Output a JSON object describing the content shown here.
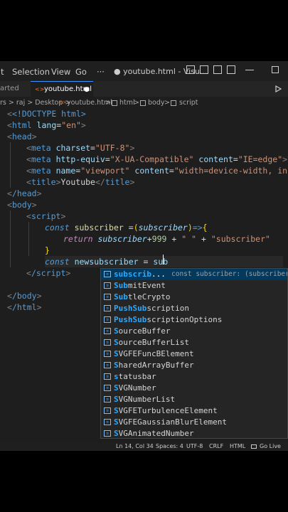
{
  "menu": {
    "item1": "t",
    "item2": "Selection",
    "item3": "View",
    "item4": "Go",
    "more": "···"
  },
  "window": {
    "title": "● youtube.html - Visu..."
  },
  "tabs": {
    "left": "arted",
    "active": "youtube.html",
    "active_modified_dot": "●"
  },
  "breadcrumb": {
    "p1": "rs > raj > Desktop >",
    "p2": "youtube.html",
    "p3": "html",
    "p4": "body",
    "p5": "script",
    "sep": ">"
  },
  "code": {
    "l1": "<!DOCTYPE html>",
    "l2_tag": "html",
    "l2_attr": "lang",
    "l2_val": "\"en\"",
    "l3_tag": "head",
    "l4_tag": "meta",
    "l4_attr": "charset",
    "l4_val": "\"UTF-8\"",
    "l5_tag": "meta",
    "l5_attr1": "http-equiv",
    "l5_val1": "\"X-UA-Compatible\"",
    "l5_attr2": "content",
    "l5_val2": "\"IE=edge\"",
    "l6_tag": "meta",
    "l6_attr1": "name",
    "l6_val1": "\"viewport\"",
    "l6_attr2": "content",
    "l6_val2": "\"width=device-width, ini",
    "l7_tag": "title",
    "l7_text": "Youtube",
    "l8_tag": "/head",
    "l9_tag": "body",
    "l10_tag": "script",
    "l11_kw": "const",
    "l11_name": "subscriber",
    "l11_param": "subscriber",
    "l12_kw": "return",
    "l12_var": "subscriber",
    "l12_num": "999",
    "l12_s1": "\" \"",
    "l12_s2": "\"subscriber\"",
    "l13": "}",
    "l14_kw": "const",
    "l14_name": "newsubscriber",
    "l14_typed": "sub",
    "l15_tag": "/script",
    "l17_tag": "/body",
    "l18_tag": "/html"
  },
  "suggestions": [
    {
      "match": "subscrib",
      "rest": "...",
      "detail": "const subscriber: (subscriber"
    },
    {
      "match": "Sub",
      "rest": "mitEvent"
    },
    {
      "match": "Sub",
      "rest": "tleCrypto"
    },
    {
      "match": "PushSub",
      "rest": "scription"
    },
    {
      "match": "PushSub",
      "rest": "scriptionOptions"
    },
    {
      "match": "S",
      "rest": "ourceBuffer"
    },
    {
      "match": "S",
      "rest": "ourceBufferList"
    },
    {
      "match": "S",
      "rest": "VGFEFuncBElement"
    },
    {
      "match": "S",
      "rest": "haredArrayBuffer"
    },
    {
      "match": "s",
      "rest": "tatusbar"
    },
    {
      "match": "S",
      "rest": "VGNumber"
    },
    {
      "match": "S",
      "rest": "VGNumberList"
    },
    {
      "match": "S",
      "rest": "VGFETurbulenceElement"
    },
    {
      "match": "S",
      "rest": "VGFEGaussianBlurElement"
    },
    {
      "match": "S",
      "rest": "VGAnimatedNumber"
    }
  ],
  "status": {
    "position": "Ln 14, Col 34",
    "spaces": "Spaces: 4",
    "encoding": "UTF-8",
    "eol": "CRLF",
    "lang": "HTML",
    "golive": "Go Live"
  },
  "icons": {
    "suggestion_kind": "variable-icon",
    "run": "play-icon"
  }
}
